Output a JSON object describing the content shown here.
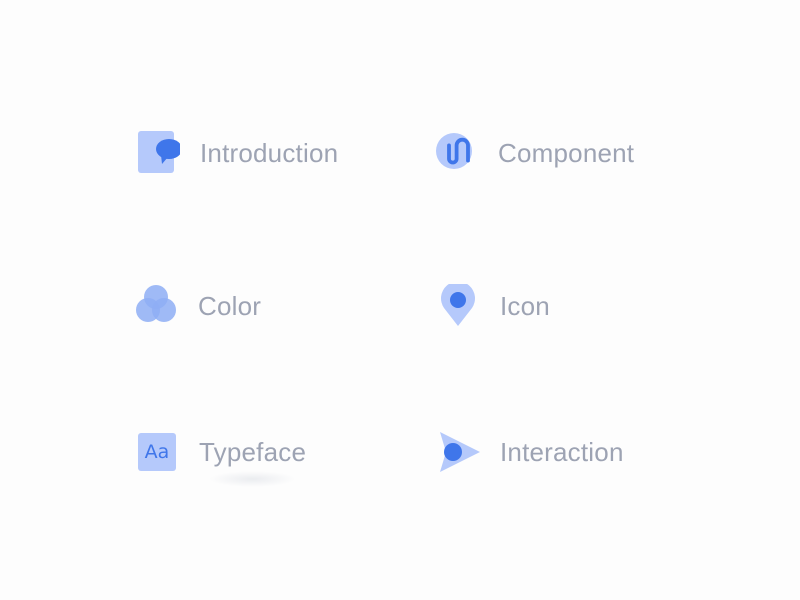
{
  "colors": {
    "light_blue": "#b5c9fb",
    "mid_blue": "#8eaef5",
    "accent_blue": "#3f76ea",
    "label_gray": "#9da3b3",
    "background": "#fdfdfd"
  },
  "menu": {
    "items": [
      {
        "label": "Introduction",
        "icon": "chat-bubble-icon"
      },
      {
        "label": "Component",
        "icon": "paperclip-icon"
      },
      {
        "label": "Color",
        "icon": "color-circles-icon"
      },
      {
        "label": "Icon",
        "icon": "location-pin-icon"
      },
      {
        "label": "Typeface",
        "icon": "typeface-icon",
        "icon_text": "Aa"
      },
      {
        "label": "Interaction",
        "icon": "cursor-pointer-icon"
      }
    ]
  }
}
